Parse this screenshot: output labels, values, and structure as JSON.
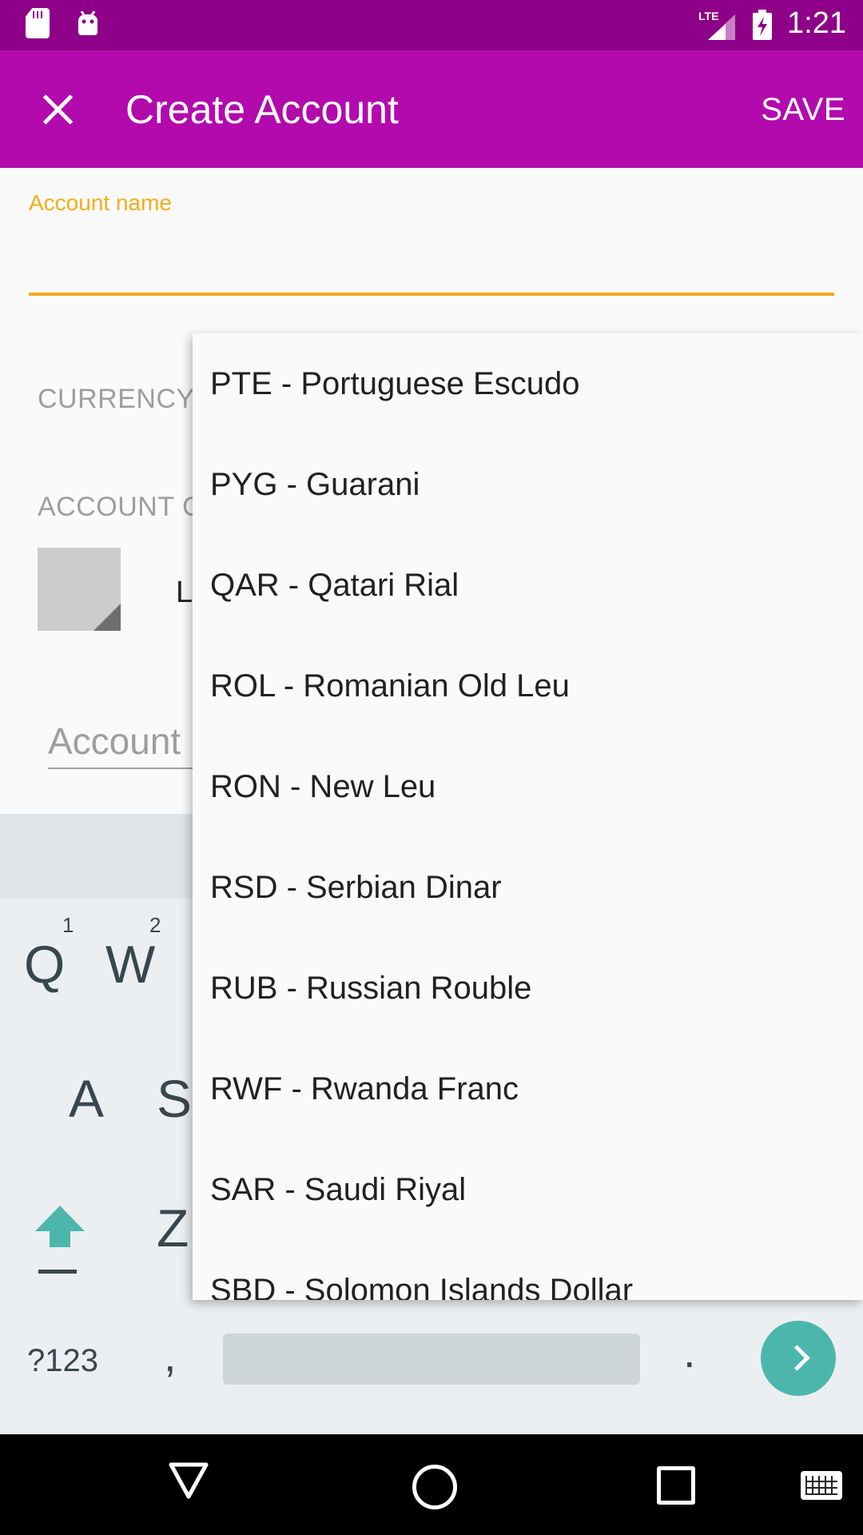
{
  "status_bar": {
    "network": "LTE",
    "time": "1:21"
  },
  "app_bar": {
    "title": "Create Account",
    "save_label": "SAVE"
  },
  "form": {
    "account_name_label": "Account name",
    "account_name_value": "",
    "currency_label": "CURRENCY",
    "account_color_label": "ACCOUNT C",
    "peek_text": "L",
    "description_placeholder": "Account"
  },
  "currency_dropdown": {
    "items": [
      "PTE - Portuguese Escudo",
      "PYG - Guarani",
      "QAR - Qatari Rial",
      "ROL - Romanian Old Leu",
      "RON - New Leu",
      "RSD - Serbian Dinar",
      "RUB - Russian Rouble",
      "RWF - Rwanda Franc",
      "SAR - Saudi Riyal",
      "SBD - Solomon Islands Dollar"
    ]
  },
  "keyboard": {
    "keys": {
      "q": "Q",
      "w": "W",
      "a": "A",
      "s": "S",
      "z": "Z"
    },
    "hints": {
      "q": "1",
      "w": "2"
    },
    "symbols_label": "?123",
    "comma": ",",
    "period": "."
  },
  "colors": {
    "status_bar": "#8e0087",
    "app_bar": "#b20aad",
    "accent": "#f6ac1a",
    "enter_key": "#4db6ac"
  },
  "icons": {
    "close": "close-icon",
    "shift": "shift-arrow-icon",
    "enter": "chevron-right-icon",
    "back": "nav-back-triangle-icon",
    "home": "nav-home-circle-icon",
    "recents": "nav-recents-square-icon",
    "keyboard": "keyboard-icon"
  }
}
